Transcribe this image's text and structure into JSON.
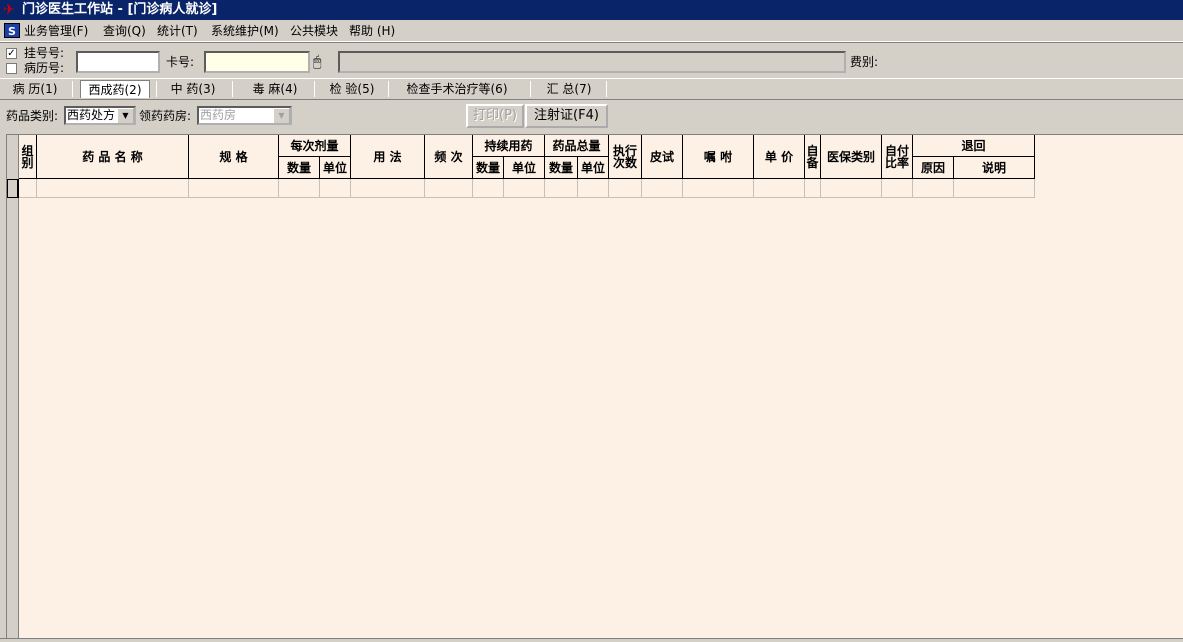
{
  "window": {
    "title": "门诊医生工作站 - [门诊病人就诊]"
  },
  "menu": {
    "items": [
      {
        "label": "业务管理(F)"
      },
      {
        "label": "查询(Q)"
      },
      {
        "label": "统计(T)"
      },
      {
        "label": "系统维护(M)"
      },
      {
        "label": "公共模块"
      },
      {
        "label": "帮助 (H)"
      }
    ]
  },
  "header": {
    "registration_label": "挂号号:",
    "registration_checked": true,
    "record_label": "病历号:",
    "record_checked": false,
    "registration_value": "",
    "card_label": "卡号:",
    "card_value": "",
    "info_value": "",
    "fee_label": "费别:"
  },
  "tabs": [
    {
      "label": "病 历(1)"
    },
    {
      "label": "西成药(2)",
      "active": true
    },
    {
      "label": "中 药(3)"
    },
    {
      "label": "毒 麻(4)"
    },
    {
      "label": "检 验(5)"
    },
    {
      "label": "检查手术治疗等(6)"
    },
    {
      "label": "汇 总(7)"
    }
  ],
  "toolbar": {
    "drug_type_label": "药品类别:",
    "drug_type_value": "西药处方",
    "pharmacy_label": "领药药房:",
    "pharmacy_value": "西药房",
    "print_label": "打印(P)",
    "injection_label": "注射证(F4)"
  },
  "grid": {
    "headers": {
      "group": "组别",
      "drug_name": "药 品 名 称",
      "spec": "规  格",
      "dose_per_time": "每次剂量",
      "dose_qty": "数量",
      "dose_unit": "单位",
      "usage": "用 法",
      "frequency": "频 次",
      "continuous": "持续用药",
      "cont_qty": "数量",
      "cont_unit": "单位",
      "total": "药品总量",
      "total_qty": "数量",
      "total_unit": "单位",
      "exec_times": "执行次数",
      "skin_test": "皮试",
      "advice": "嘱 咐",
      "unit_price": "单 价",
      "self_prepared": "自备",
      "insurance_type": "医保类别",
      "self_pay_ratio": "自付比率",
      "return": "退回",
      "reason": "原因",
      "note": "说明"
    }
  },
  "colors": {
    "title_bar": "#0a246a",
    "grid_background": "#fdf1e6",
    "face": "#d4d0c8"
  }
}
